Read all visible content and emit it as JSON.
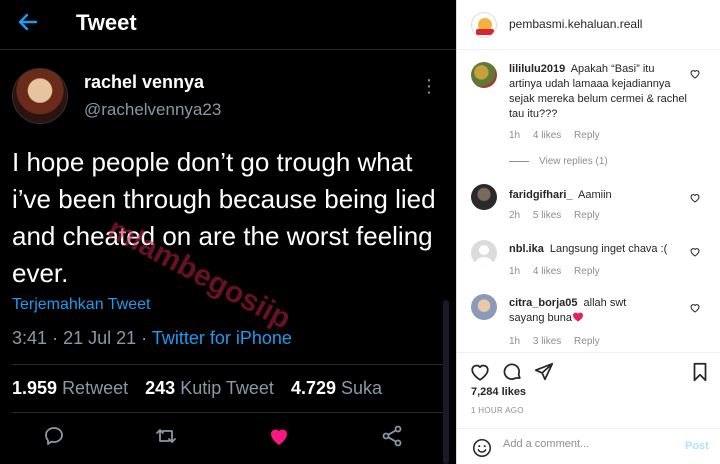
{
  "tweet": {
    "header_title": "Tweet",
    "name": "rachel vennya",
    "handle": "@rachelvennya23",
    "text": "I hope people don’t go trough what i’ve been through because being lied and cheated on are the worst feeling ever.",
    "watermark": "mlambegosiip",
    "translate_label": "Terjemahkan Tweet",
    "time": "3:41",
    "date": "21 Jul 21",
    "source": "Twitter for iPhone",
    "retweets": "1.959",
    "retweets_label": "Retweet",
    "quotes": "243",
    "quotes_label": "Kutip Tweet",
    "likes": "4.729",
    "likes_label": "Suka",
    "accent_color": "#1d9bf0",
    "like_color": "#f91880"
  },
  "instagram": {
    "username": "pembasmi.kehaluan.reall",
    "comments": [
      {
        "user": "lililulu2019",
        "text": "Apakah “Basi” itu artinya udah lamaaa kejadiannya sejak mereka belum cermei & rachel tau itu???",
        "time": "1h",
        "likes": "4 likes",
        "reply": "Reply",
        "view_replies": "View replies (1)"
      },
      {
        "user": "faridgifhari_",
        "text": "Aamiin",
        "time": "2h",
        "likes": "5 likes",
        "reply": "Reply"
      },
      {
        "user": "nbl.ika",
        "text": "Langsung inget chava :(",
        "time": "1h",
        "likes": "4 likes",
        "reply": "Reply"
      },
      {
        "user": "citra_borja05",
        "text": "allah swt sayang buna",
        "time": "1h",
        "likes": "3 likes",
        "reply": "Reply"
      }
    ],
    "likes_count": "7,284 likes",
    "posted_time": "1 HOUR AGO",
    "add_comment_placeholder": "Add a comment...",
    "post_label": "Post"
  }
}
